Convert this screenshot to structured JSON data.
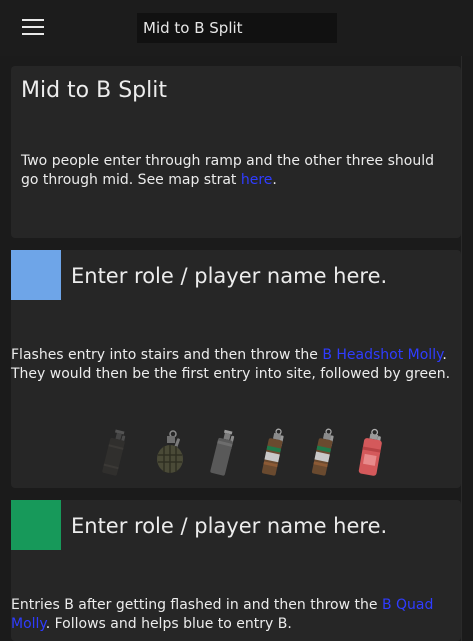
{
  "header": {
    "menu_icon": "hamburger-menu-icon",
    "title_value": "Mid to B Split"
  },
  "plan": {
    "title": "Mid to B Split",
    "desc_text": "Two people enter through ramp and the other three should go through mid. See map strat ",
    "desc_link": "here",
    "desc_end": "."
  },
  "roles": [
    {
      "color": "#6ea5e8",
      "placeholder": "Enter role / player name here.",
      "desc_text": "Flashes entry into stairs and then throw the ",
      "desc_link": "B Headshot Molly",
      "desc_end": ". They would then be the first entry into site, followed by green.",
      "equipment": [
        "smoke-grenade-icon",
        "he-grenade-icon",
        "decoy-grenade-icon",
        "flashbang-icon",
        "flashbang-icon",
        "incendiary-grenade-icon"
      ]
    },
    {
      "color": "#17995a",
      "placeholder": "Enter role / player name here.",
      "desc_text": "Entries B after getting flashed in and then throw the ",
      "desc_link": "B Quad Molly",
      "desc_end": ". Follows and helps blue to entry B."
    }
  ],
  "colors": {
    "background": "#1b1b1b",
    "card": "#262626",
    "link": "#2f3cff"
  }
}
